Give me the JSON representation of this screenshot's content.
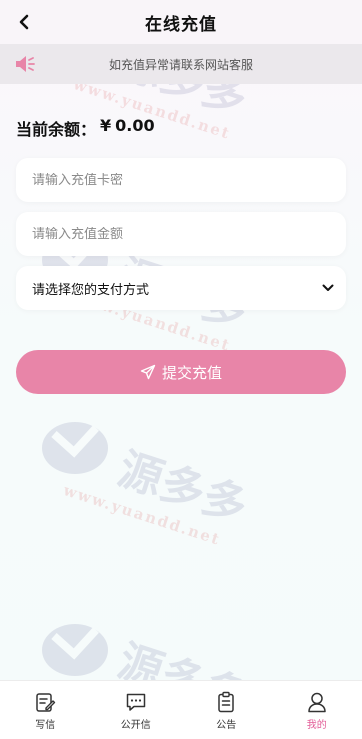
{
  "header": {
    "title": "在线充值"
  },
  "notice": {
    "text": "如充值异常请联系网站客服",
    "accent": "#e885a8"
  },
  "balance": {
    "label": "当前余额：",
    "currency": "¥",
    "amount": "0.00"
  },
  "form": {
    "card_placeholder": "请输入充值卡密",
    "amount_placeholder": "请输入充值金额",
    "payment_select": "请选择您的支付方式"
  },
  "submit": {
    "label": "提交充值",
    "color": "#e885a8"
  },
  "watermark": {
    "brand": "源多多",
    "url": "www.yuandd.net"
  },
  "tabbar": {
    "items": [
      {
        "label": "写信",
        "icon": "write-icon"
      },
      {
        "label": "公开信",
        "icon": "chat-icon"
      },
      {
        "label": "公告",
        "icon": "clipboard-icon"
      },
      {
        "label": "我的",
        "icon": "user-icon",
        "active": true
      }
    ],
    "active_color": "#e25c97"
  }
}
